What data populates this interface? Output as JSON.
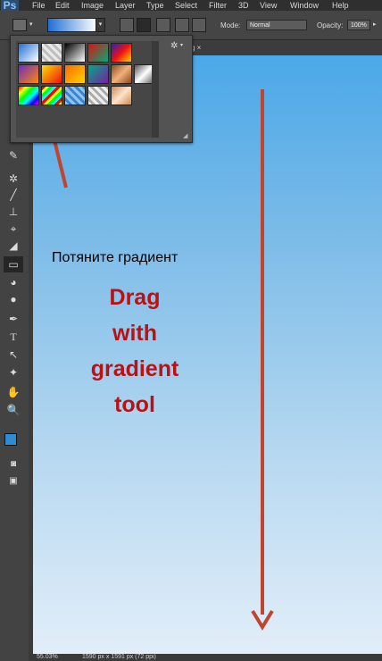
{
  "app": {
    "logo": "Ps"
  },
  "menubar": {
    "items": [
      "File",
      "Edit",
      "Image",
      "Layer",
      "Type",
      "Select",
      "Filter",
      "3D",
      "View",
      "Window",
      "Help"
    ]
  },
  "options_bar": {
    "mode_label": "Mode:",
    "mode_value": "Normal",
    "opacity_label": "Opacity:",
    "opacity_value": "100%",
    "gradient_colors": {
      "from": "#1f6fd6",
      "to": "#ffffff"
    }
  },
  "gradient_picker": {
    "gear_icon": "gear-icon",
    "presets": [
      "blue-white",
      "transparent",
      "black-white",
      "red-green",
      "blue-red-yellow",
      "violet-orange",
      "yellow-red",
      "orange-yellow",
      "green-purple",
      "copper",
      "chrome",
      "rainbow",
      "rainbow-2",
      "blue-stripes",
      "transparent-stripes",
      "copper-light"
    ]
  },
  "document_tab": {
    "close_glyph": "g ×"
  },
  "tools": [
    "move",
    "marquee",
    "lasso",
    "quick-select",
    "crop",
    "eyedropper",
    "healing",
    "brush",
    "stamp",
    "history-brush",
    "eraser",
    "gradient",
    "blur",
    "dodge",
    "pen",
    "type",
    "path-select",
    "shape",
    "hand",
    "zoom"
  ],
  "foreground_color": "#2e8bd4",
  "background_color": "#ffffff",
  "overlay": {
    "russian": "Потяните градиент",
    "english": "Drag\nwith\ngradient\ntool",
    "text_color": "#b91114",
    "arrow_color": "#c0452f"
  },
  "status": {
    "zoom": "55.03%",
    "doc_info": "1590 px x 1591 px (72 ppi)"
  }
}
